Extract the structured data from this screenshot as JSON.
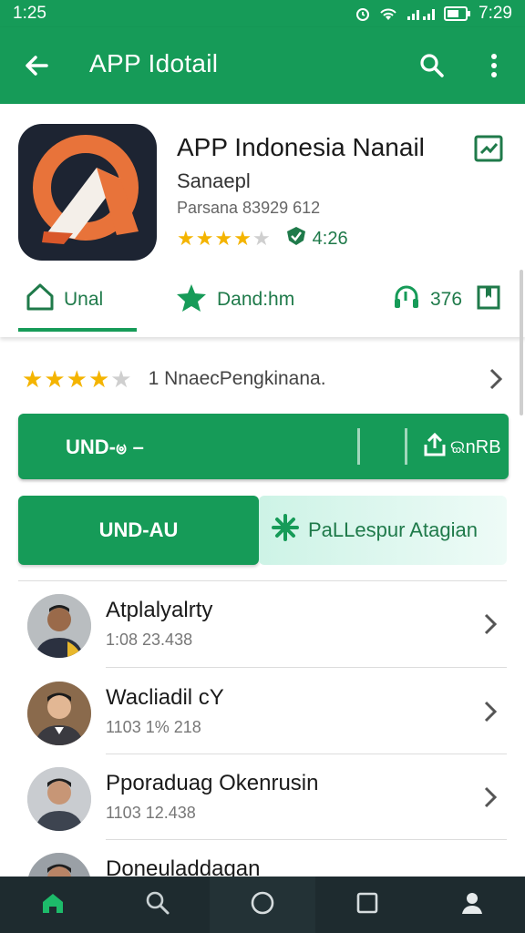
{
  "status_bar": {
    "time_left": "1:25",
    "time_right": "7:29"
  },
  "app_bar": {
    "title": "APP Idotail",
    "back_icon": "arrow-back-icon",
    "search_icon": "search-icon",
    "more_icon": "more-vert-icon"
  },
  "app": {
    "name": "APP Indonesia Nanail",
    "developer": "Sanaepl",
    "meta": "Parsana 83929 612",
    "rating_stars": 4,
    "rating_max": 5,
    "score": "4:26",
    "icon": "app-logo-icon"
  },
  "tabs": [
    {
      "label": "Unal",
      "icon": "home-outline-icon",
      "selected": true
    },
    {
      "label": "Dand:hm",
      "icon": "star-icon",
      "selected": false
    },
    {
      "label": "376",
      "icon": "headset-icon",
      "selected": false
    }
  ],
  "review_summary": {
    "stars": 4,
    "text": "1  NnaecPengkinana."
  },
  "primary_button": {
    "label": "UND-ၑ –",
    "share_label": "ଇnRB"
  },
  "secondary_buttons": {
    "left": "UND-AU",
    "right": "PaLLespur Atagian"
  },
  "list": [
    {
      "title": "Atplalyalrty",
      "subtitle": "1:08 23.438"
    },
    {
      "title": "Wacliadil cY",
      "subtitle": "1103 1% 218"
    },
    {
      "title": "Pporaduag Okenrusin",
      "subtitle": "1103 12.438"
    },
    {
      "title": "Doneuladdagan",
      "subtitle": ""
    }
  ],
  "colors": {
    "brand": "#169b58",
    "star": "#f4b400",
    "nav_bg": "#1e2b2f"
  }
}
